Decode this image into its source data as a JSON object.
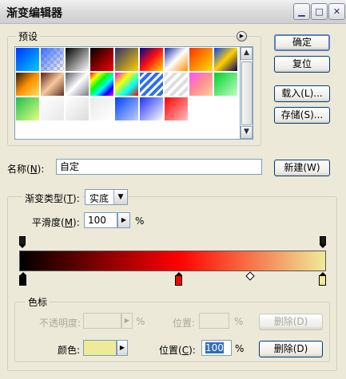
{
  "window": {
    "title": "渐变编辑器"
  },
  "presets": {
    "legend": "预设",
    "swatches": [
      "linear-gradient(135deg,#0033ff,#00ccff)",
      "linear-gradient(135deg,#3a6cff,transparent)",
      "linear-gradient(135deg,#000,#fff)",
      "linear-gradient(135deg,#000,#ff0000)",
      "linear-gradient(135deg,#2e2e6e,#ffd000)",
      "linear-gradient(135deg,#000090,#ff1010,#ffe000)",
      "linear-gradient(135deg,#1a2aa0,#ffffff,#ff9000)",
      "linear-gradient(135deg,#ff3000,#ffe000)",
      "linear-gradient(135deg,#0040ff,#ffd000,#000060)",
      "linear-gradient(135deg,#2c1a10,#ff9000,#ffe060)",
      "linear-gradient(135deg,#5a2010,#f8c8a0,#603020)",
      "linear-gradient(135deg,#5a5a6a,#ffffff,#7a7a8a)",
      "linear-gradient(135deg,#ff0000,#ffff00,#00ff00,#00ffff,#0000ff,#ff00ff)",
      "linear-gradient(135deg,#ff00ff,#ffff00,#00ffff,#ff0000)",
      "repeating-linear-gradient(135deg,#2a6cff 0 4px,#fff 4px 7px)",
      "repeating-linear-gradient(135deg,#ddd 0 4px,#fff 4px 8px)",
      "linear-gradient(135deg,#ff50ff,#ff9090,#ffcfa0)",
      "linear-gradient(135deg,#00d030,#c0ffc0)",
      "linear-gradient(135deg,#1ebe4e,#e8ff80)",
      "linear-gradient(135deg,#ffffff,#e8e8e8)",
      "linear-gradient(135deg,#ffffff,#dcdcdc)",
      "linear-gradient(135deg,#eaeaea,#ffffff)",
      "linear-gradient(135deg,#0040ff,#c0d0ff)",
      "linear-gradient(135deg,#2030ff,#ffffff)",
      "linear-gradient(135deg,#ff0000,#ffc0c0)"
    ]
  },
  "buttons": {
    "ok": "确定",
    "reset": "复位",
    "load": "载入(L)...",
    "save": "存储(S)...",
    "new": "新建(W)",
    "delete_disabled": "删除(D)",
    "delete": "删除(D)"
  },
  "name": {
    "label_prefix": "名称(",
    "label_key": "N",
    "label_suffix": "):",
    "value": "自定"
  },
  "gradient": {
    "type_label_prefix": "渐变类型(",
    "type_label_key": "T",
    "type_label_suffix": "):",
    "type_value": "实底",
    "smooth_label_prefix": "平滑度(",
    "smooth_label_key": "M",
    "smooth_label_suffix": "):",
    "smooth_value": "100",
    "smooth_unit": "%",
    "stops": [
      {
        "position": 0,
        "color": "#000000"
      },
      {
        "position": 52,
        "color": "#ff0000"
      },
      {
        "position": 100,
        "color": "#eeeb98"
      }
    ],
    "opacity_stops": [
      {
        "position": 0
      },
      {
        "position": 100
      }
    ],
    "midpoint_percent": 75
  },
  "color_stops": {
    "legend": "色标",
    "opacity_label": "不透明度:",
    "opacity_unit": "%",
    "location_label": "位置:",
    "location_unit": "%",
    "color_label": "颜色:",
    "color_value": "#eeeb98",
    "pos_label_prefix": "位置(",
    "pos_label_key": "C",
    "pos_label_suffix": "):",
    "pos_value": "100",
    "pos_unit": "%"
  }
}
